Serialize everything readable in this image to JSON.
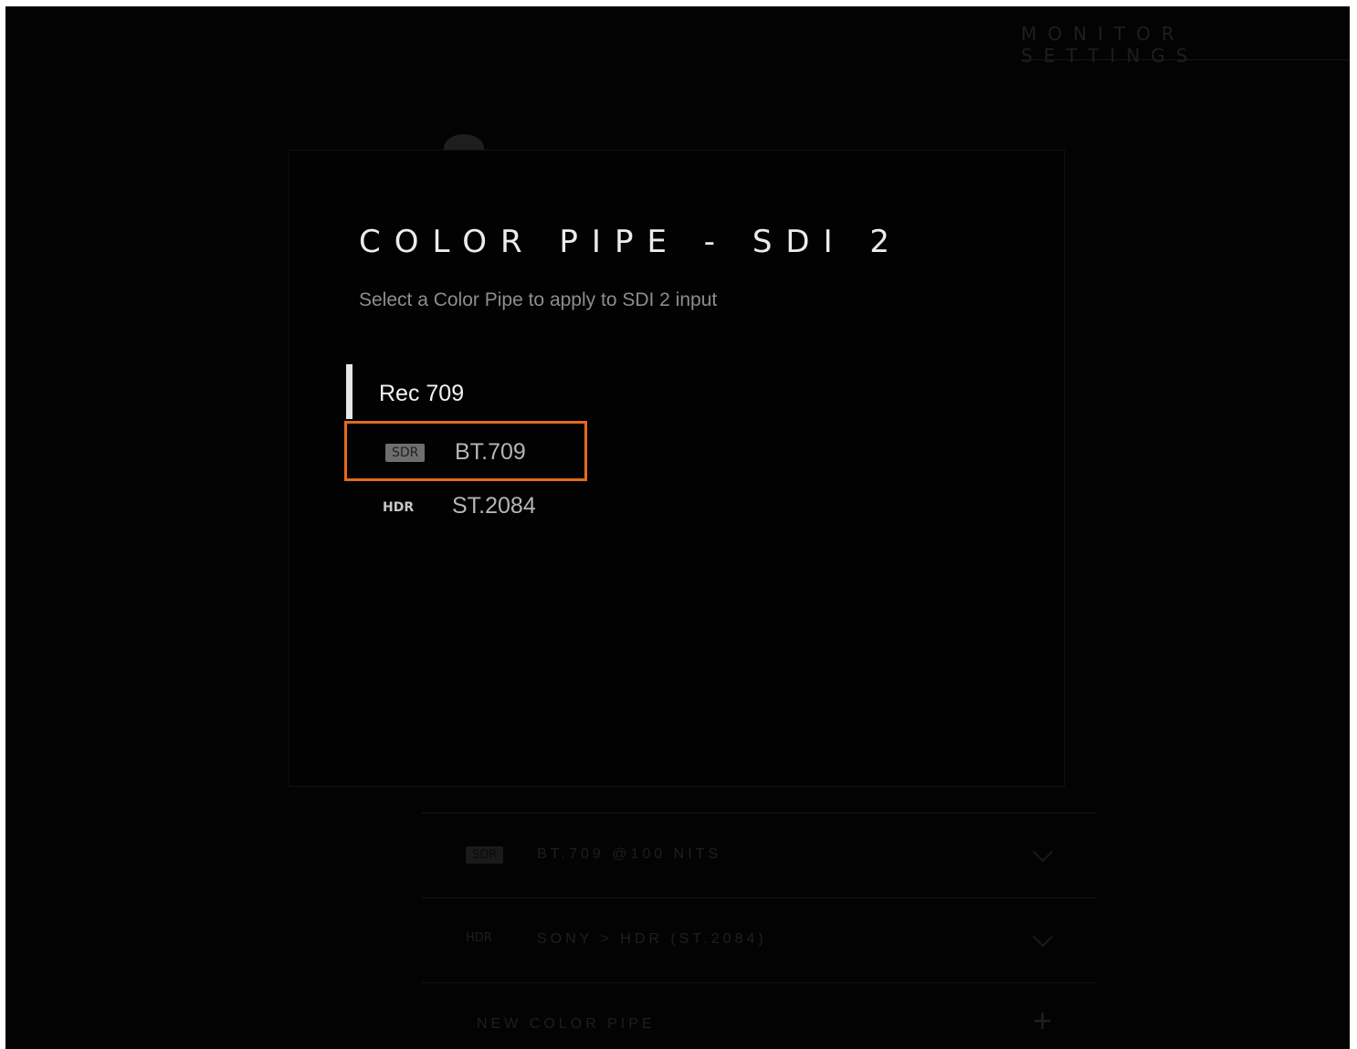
{
  "background": {
    "header_title": "MONITOR SETTINGS",
    "pipes": [
      {
        "tag": "SDR",
        "label": "BT.709 @100 NITS"
      },
      {
        "tag": "HDR",
        "label": "SONY > HDR (ST.2084)"
      }
    ],
    "new_pipe_label": "NEW COLOR PIPE",
    "new_pipe_icon": "plus-icon"
  },
  "modal": {
    "title": "COLOR PIPE - SDI 2",
    "subtitle": "Select a Color Pipe to apply to SDI 2 input",
    "group_label": "Rec 709",
    "options": [
      {
        "tag": "SDR",
        "label": "BT.709",
        "selected": true
      },
      {
        "tag": "HDR",
        "label": "ST.2084",
        "selected": false
      }
    ]
  },
  "colors": {
    "highlight": "#e36a1c",
    "background": "#030303"
  }
}
